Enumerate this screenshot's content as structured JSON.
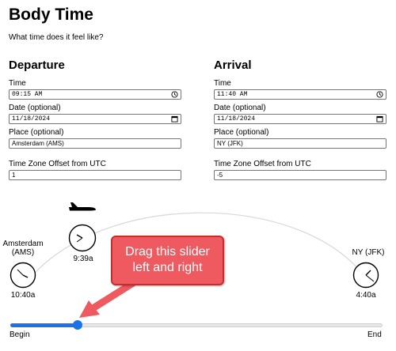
{
  "app": {
    "title": "Body Time",
    "subtitle": "What time does it feel like?"
  },
  "departure": {
    "heading": "Departure",
    "time_label": "Time",
    "time_value": "09:15 AM",
    "date_label": "Date (optional)",
    "date_value": "11/18/2024",
    "place_label": "Place (optional)",
    "place_value": "Amsterdam (AMS)",
    "tz_label": "Time Zone Offset from UTC",
    "tz_value": "1"
  },
  "arrival": {
    "heading": "Arrival",
    "time_label": "Time",
    "time_value": "11:40 AM",
    "date_label": "Date (optional)",
    "date_value": "11/18/2024",
    "place_label": "Place (optional)",
    "place_value": "NY (JFK)",
    "tz_label": "Time Zone Offset from UTC",
    "tz_value": "-5"
  },
  "journey": {
    "origin_name": "Amsterdam (AMS)",
    "origin_clock": "10:40a",
    "current_clock": "9:39a",
    "destination_name": "NY (JFK)",
    "destination_clock": "4:40a",
    "slider_fraction": 0.18,
    "begin_label": "Begin",
    "end_label": "End"
  },
  "callout": {
    "line1": "Drag this slider",
    "line2": "left and right"
  },
  "colors": {
    "accent": "#1a73e8",
    "callout": "#ee5a5f",
    "callout_border": "#c0302f"
  },
  "icons": {
    "clock": "clock-icon",
    "calendar": "calendar-icon",
    "plane": "airplane-icon"
  }
}
